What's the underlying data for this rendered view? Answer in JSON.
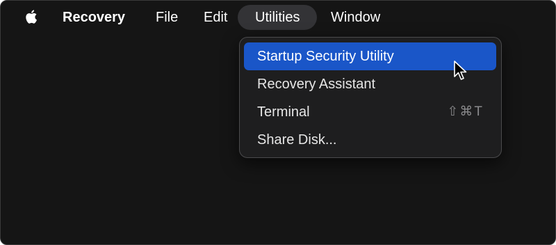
{
  "menubar": {
    "apple_icon": "apple-logo-icon",
    "app_name": "Recovery",
    "items": [
      {
        "label": "File"
      },
      {
        "label": "Edit"
      },
      {
        "label": "Utilities",
        "active": true
      },
      {
        "label": "Window"
      }
    ]
  },
  "utilities_menu": {
    "items": [
      {
        "label": "Startup Security Utility",
        "highlighted": true,
        "shortcut": ""
      },
      {
        "label": "Recovery Assistant",
        "shortcut": ""
      },
      {
        "label": "Terminal",
        "shortcut": "⇧⌘T"
      },
      {
        "label": "Share Disk...",
        "shortcut": ""
      }
    ]
  },
  "pointer_icon": "arrow-cursor-icon",
  "colors": {
    "background": "#151515",
    "highlight": "#1a56c8",
    "active_menu_pill": "#333336",
    "menu_background": "#1e1e1f"
  }
}
